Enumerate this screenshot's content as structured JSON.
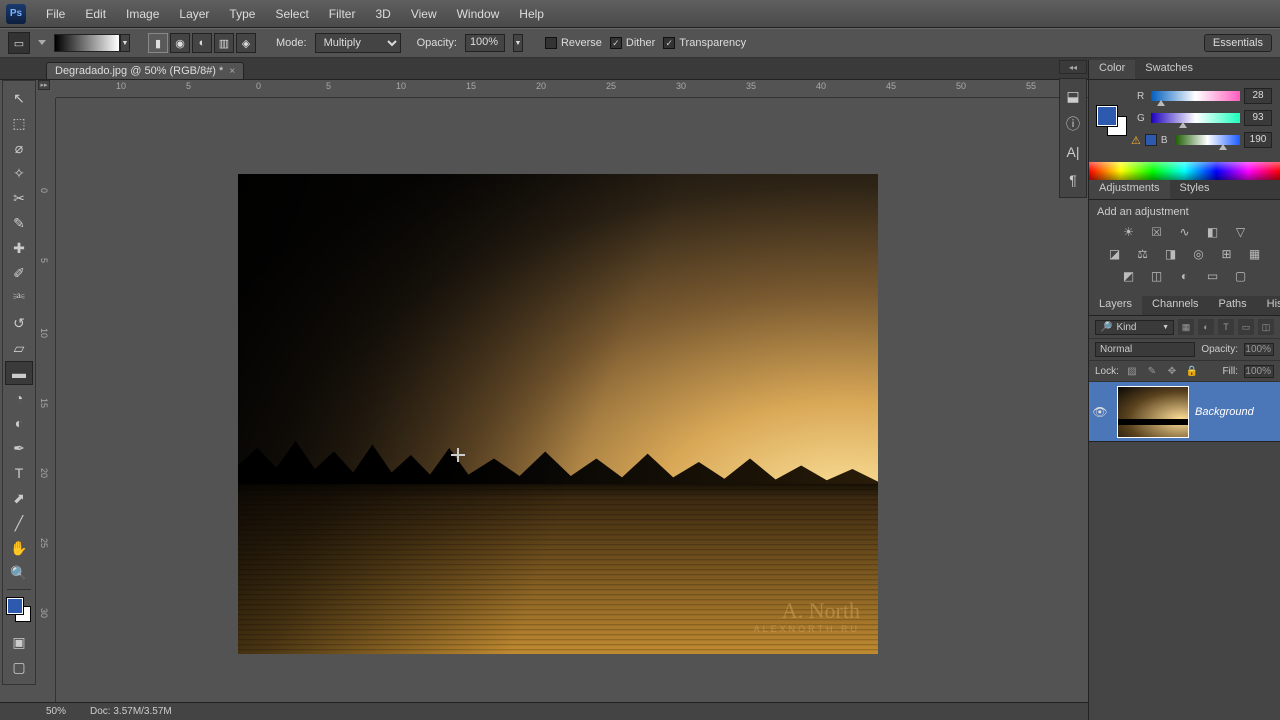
{
  "app": {
    "logo": "Ps"
  },
  "menu": [
    "File",
    "Edit",
    "Image",
    "Layer",
    "Type",
    "Select",
    "Filter",
    "3D",
    "View",
    "Window",
    "Help"
  ],
  "options": {
    "mode_label": "Mode:",
    "mode_value": "Multiply",
    "opacity_label": "Opacity:",
    "opacity_value": "100%",
    "reverse": {
      "label": "Reverse",
      "checked": false
    },
    "dither": {
      "label": "Dither",
      "checked": true
    },
    "transparency": {
      "label": "Transparency",
      "checked": true
    },
    "workspace": "Essentials"
  },
  "document": {
    "tab_title": "Degradado.jpg @ 50% (RGB/8#) *",
    "zoom": "50%",
    "doc_size": "Doc: 3.57M/3.57M"
  },
  "ruler_h": [
    "10",
    "5",
    "0",
    "5",
    "10",
    "15",
    "20",
    "25",
    "30",
    "35",
    "40",
    "45",
    "50",
    "55"
  ],
  "ruler_v": [
    "0",
    "5",
    "10",
    "15",
    "20",
    "25",
    "30"
  ],
  "color_panel": {
    "tabs": [
      "Color",
      "Swatches"
    ],
    "r_label": "R",
    "r_value": "28",
    "g_label": "G",
    "g_value": "93",
    "b_label": "B",
    "b_value": "190"
  },
  "adjustments": {
    "tabs": [
      "Adjustments",
      "Styles"
    ],
    "prompt": "Add an adjustment"
  },
  "layers": {
    "tabs": [
      "Layers",
      "Channels",
      "Paths",
      "History"
    ],
    "filter_kind": "Kind",
    "blend_mode": "Normal",
    "opacity_label": "Opacity:",
    "opacity_value": "100%",
    "lock_label": "Lock:",
    "fill_label": "Fill:",
    "fill_value": "100%",
    "items": [
      {
        "name": "Background",
        "visible": true
      }
    ]
  },
  "watermark": {
    "sig": "A. North",
    "site": "ALEXNORTH.RU"
  }
}
